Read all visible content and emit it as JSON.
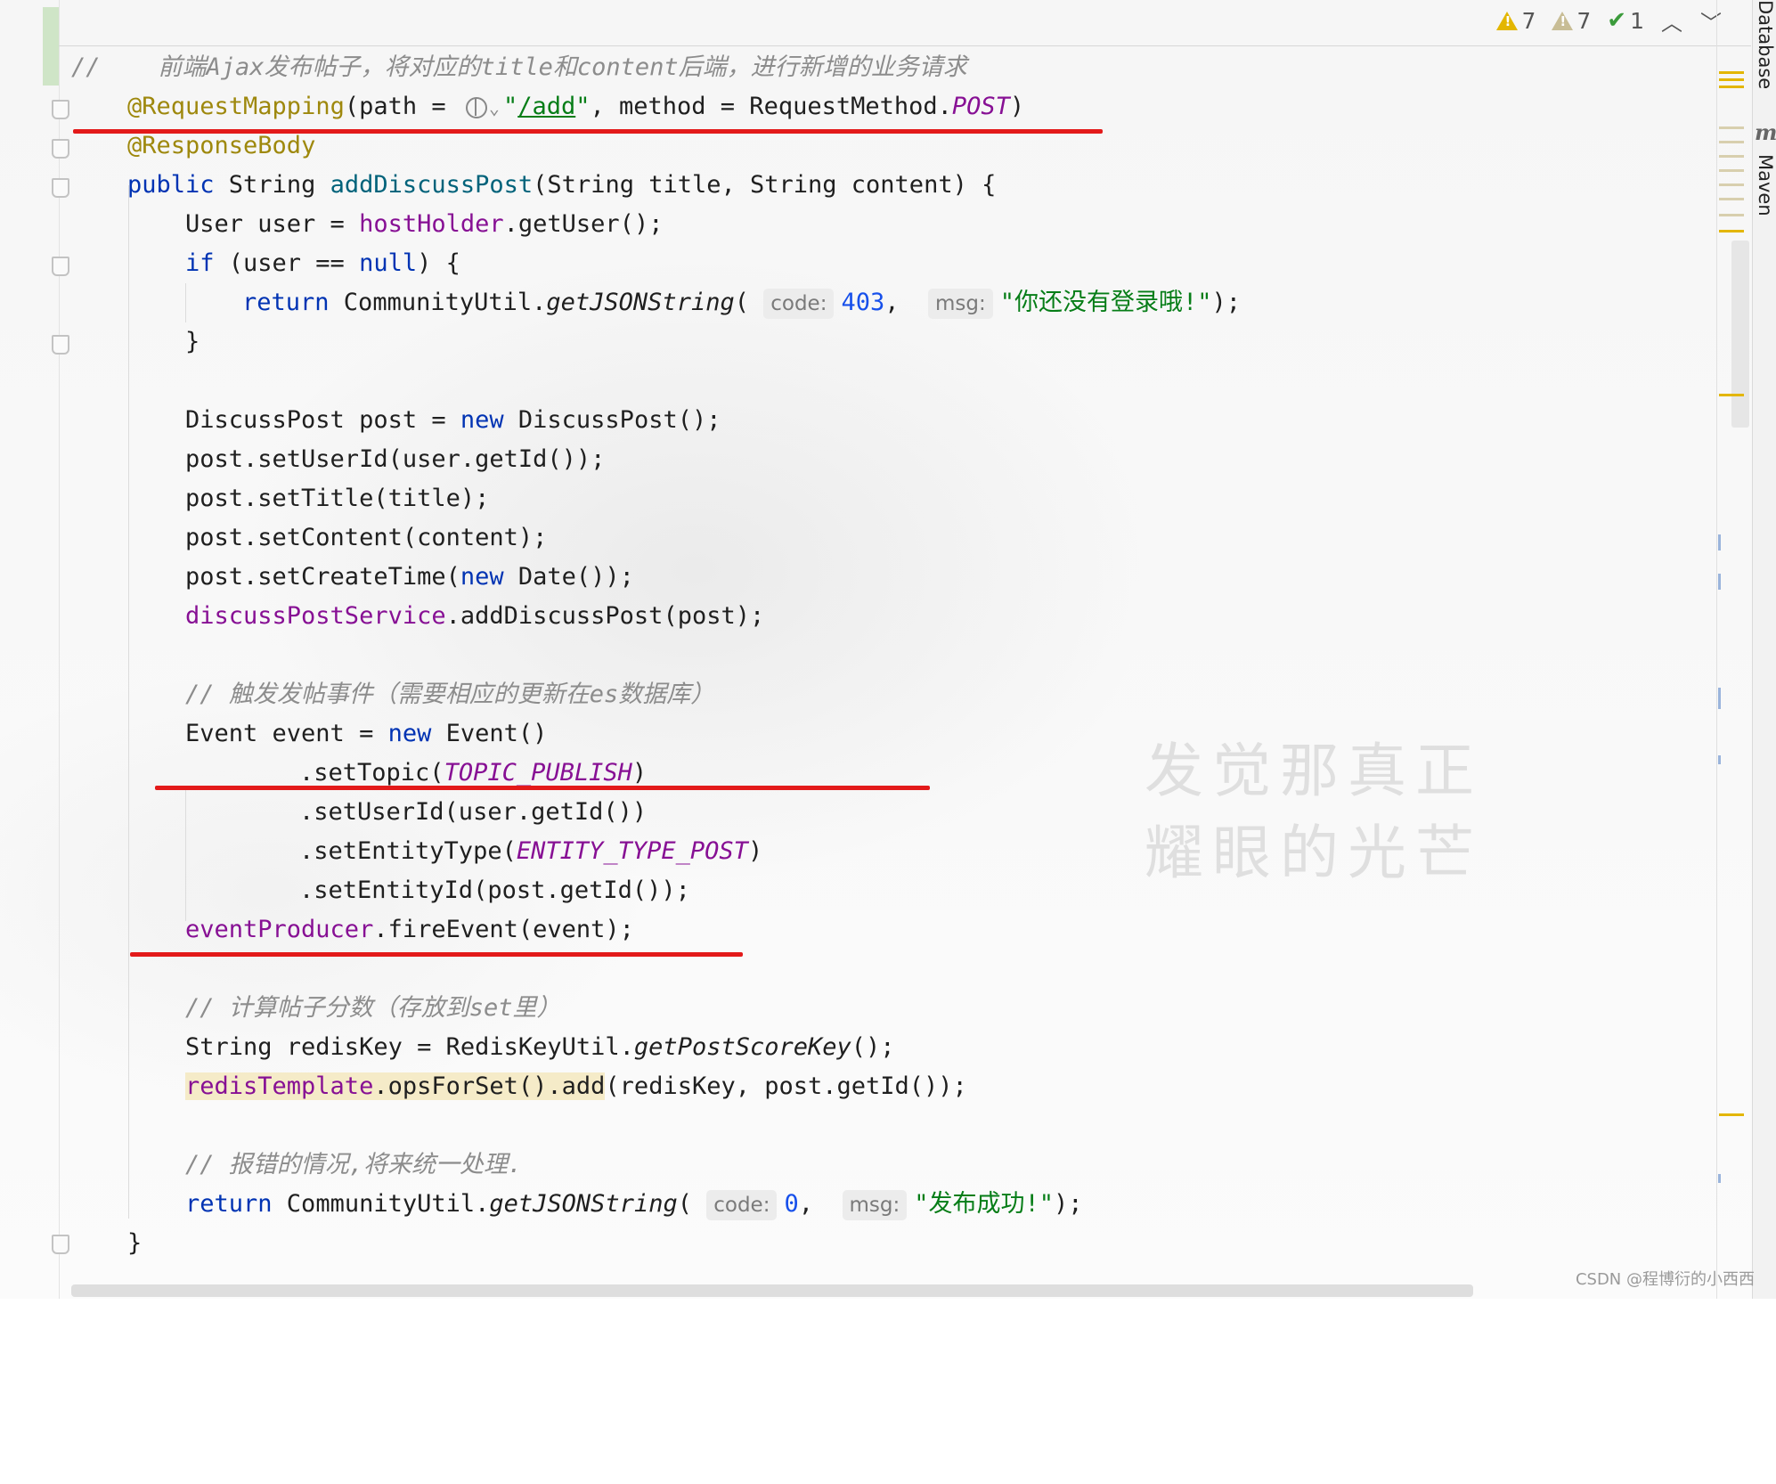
{
  "inspection": {
    "warnings_count": "7",
    "weak_warnings_count": "7",
    "typos_count": "1",
    "warning_icon": "warning-triangle-icon",
    "weak_warning_icon": "weak-warning-triangle-icon",
    "typo_icon": "check-icon",
    "prev_icon": "chevron-up-icon",
    "next_icon": "chevron-down-icon"
  },
  "tool_windows": {
    "database": "Database",
    "maven": "Maven",
    "maven_glyph": "m"
  },
  "code": {
    "l1": {
      "slash": "//",
      "text": "    前端Ajax发布帖子，将对应的title和content后端，进行新增的业务请求"
    },
    "l2": {
      "ann": "@RequestMapping",
      "a": "(path = ",
      "q1": "\"",
      "link": "/add",
      "q2": "\"",
      "b": ", method = RequestMethod.",
      "post": "POST",
      "c": ")"
    },
    "l3": {
      "ann": "@ResponseBody"
    },
    "l4": {
      "kw": "public",
      "a": " String ",
      "m": "addDiscussPost",
      "b": "(String title, String content) {"
    },
    "l5": {
      "a": "User user = ",
      "f": "hostHolder",
      "b": ".getUser();"
    },
    "l6": {
      "kw": "if",
      "a": " (user == ",
      "kw2": "null",
      "b": ") {"
    },
    "l7": {
      "kw": "return",
      "a": " CommunityUtil.",
      "m": "getJSONString",
      "b": "( ",
      "h1": "code:",
      "n": "403",
      "c": ",  ",
      "h2": "msg:",
      "s": "\"你还没有登录哦!\"",
      "d": ");"
    },
    "l8": {
      "a": "}"
    },
    "l9": {
      "a": "DiscussPost post = ",
      "kw": "new",
      "b": " DiscussPost();"
    },
    "l10": {
      "a": "post.setUserId(user.getId());"
    },
    "l11": {
      "a": "post.setTitle(title);"
    },
    "l12": {
      "a": "post.setContent(content);"
    },
    "l13": {
      "a": "post.setCreateTime(",
      "kw": "new",
      "b": " Date());"
    },
    "l14": {
      "f": "discussPostService",
      "a": ".addDiscussPost(post);"
    },
    "l15": {
      "c": "// 触发发帖事件（需要相应的更新在es数据库）"
    },
    "l16": {
      "a": "Event event = ",
      "kw": "new",
      "b": " Event()"
    },
    "l17": {
      "a": ".setTopic(",
      "k": "TOPIC_PUBLISH",
      "b": ")"
    },
    "l18": {
      "a": ".setUserId(user.getId())"
    },
    "l19": {
      "a": ".setEntityType(",
      "k": "ENTITY_TYPE_POST",
      "b": ")"
    },
    "l20": {
      "a": ".setEntityId(post.getId());"
    },
    "l21": {
      "f": "eventProducer",
      "a": ".fireEvent(event);"
    },
    "l22": {
      "c": "// 计算帖子分数（存放到set里）"
    },
    "l23": {
      "a": "String redisKey = RedisKeyUtil.",
      "m": "getPostScoreKey",
      "b": "();"
    },
    "l24": {
      "f": "redisTemplate",
      "h": ".opsForSet().add",
      "a": "(redisKey, post.getId());"
    },
    "l25": {
      "c": "// 报错的情况,将来统一处理."
    },
    "l26": {
      "kw": "return",
      "a": " CommunityUtil.",
      "m": "getJSONString",
      "b": "( ",
      "h1": "code:",
      "n": "0",
      "c": ",  ",
      "h2": "msg:",
      "s": "\"发布成功!\"",
      "d": ");"
    },
    "l27": {
      "a": "}"
    }
  },
  "watermark": {
    "line1": "发觉那真正",
    "line2": "耀眼的光芒"
  },
  "credit": "CSDN @程博衍的小西西",
  "colors": {
    "keyword": "#0033b3",
    "annotation": "#9e880d",
    "string": "#067d17",
    "field": "#871094",
    "comment": "#8c8c8c",
    "number": "#1750eb",
    "annotation_underline": "#e31a1a"
  }
}
